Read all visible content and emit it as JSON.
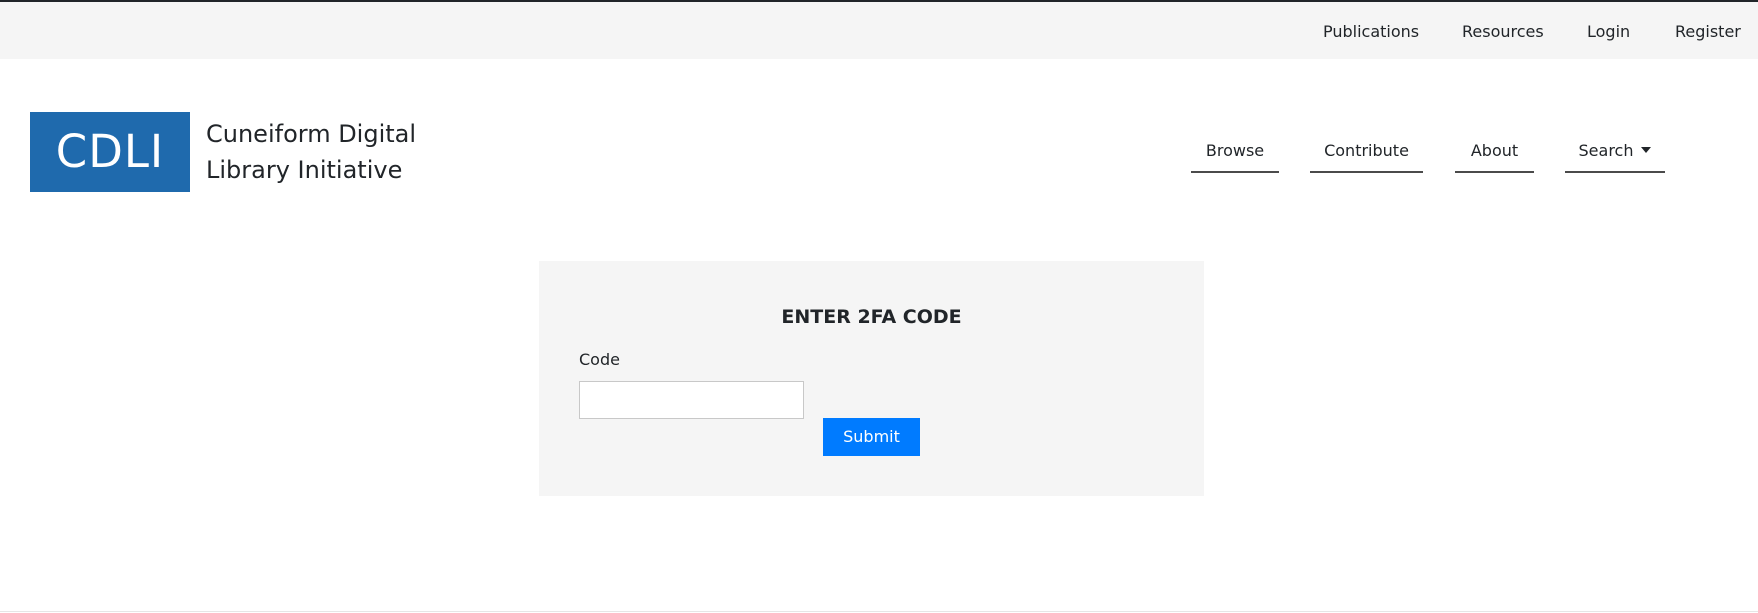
{
  "top_nav": {
    "publications": "Publications",
    "resources": "Resources",
    "login": "Login",
    "register": "Register"
  },
  "brand": {
    "logo_text": "CDLI",
    "site_name": "Cuneiform Digital Library Initiative",
    "logo_color": "#1f6aad"
  },
  "main_nav": {
    "browse": "Browse",
    "contribute": "Contribute",
    "about": "About",
    "search": "Search"
  },
  "twofa_form": {
    "title": "ENTER 2FA CODE",
    "code_label": "Code",
    "code_value": "",
    "submit_label": "Submit",
    "submit_color": "#007bff"
  }
}
